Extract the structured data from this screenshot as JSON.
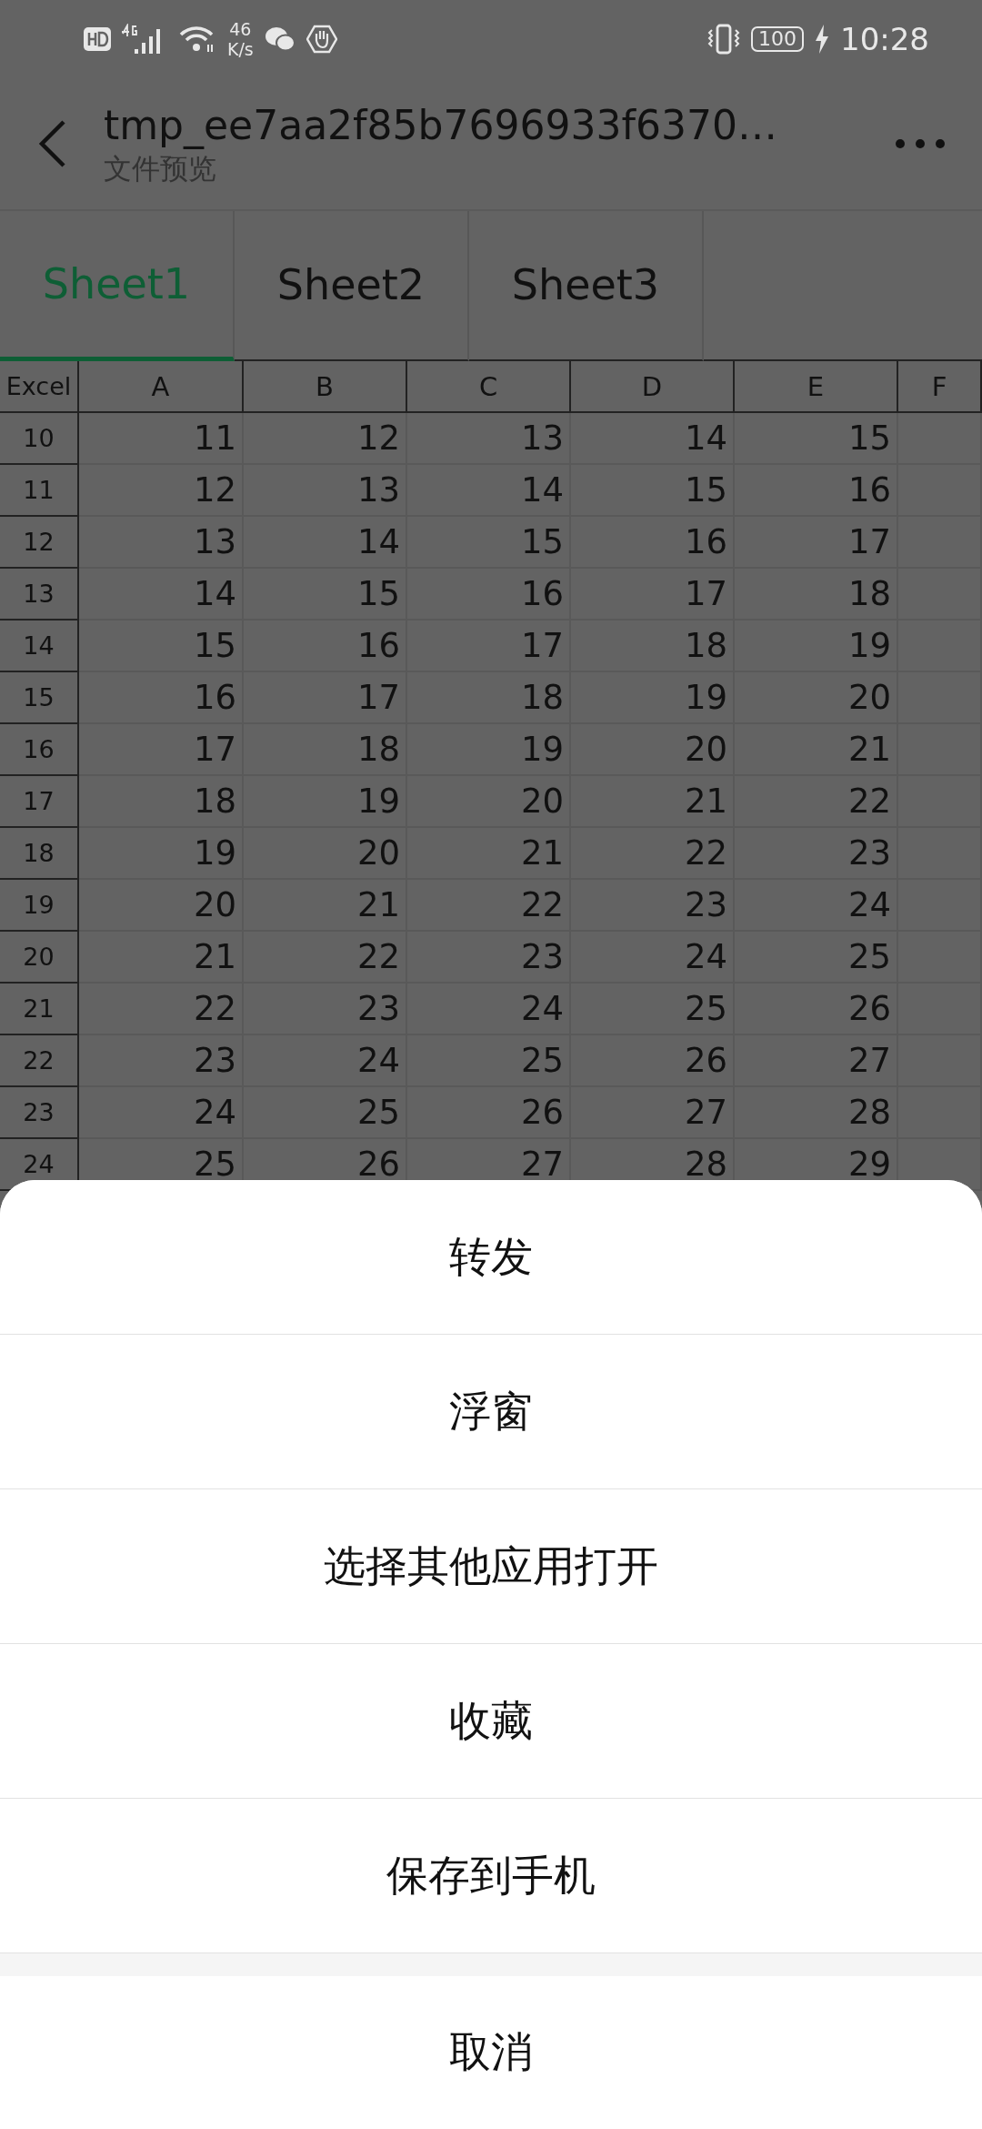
{
  "status_bar": {
    "speed_value": "46",
    "speed_unit": "K/s",
    "battery": "100",
    "time": "10:28"
  },
  "header": {
    "title": "tmp_ee7aa2f85b7696933f6370…",
    "subtitle": "文件预览"
  },
  "tabs": [
    {
      "label": "Sheet1",
      "selected": true
    },
    {
      "label": "Sheet2",
      "selected": false
    },
    {
      "label": "Sheet3",
      "selected": false
    }
  ],
  "table": {
    "columns": [
      "Excel",
      "A",
      "B",
      "C",
      "D",
      "E",
      "F"
    ],
    "rows": [
      {
        "header": "10",
        "cells": [
          "11",
          "12",
          "13",
          "14",
          "15"
        ]
      },
      {
        "header": "11",
        "cells": [
          "12",
          "13",
          "14",
          "15",
          "16"
        ]
      },
      {
        "header": "12",
        "cells": [
          "13",
          "14",
          "15",
          "16",
          "17"
        ]
      },
      {
        "header": "13",
        "cells": [
          "14",
          "15",
          "16",
          "17",
          "18"
        ]
      },
      {
        "header": "14",
        "cells": [
          "15",
          "16",
          "17",
          "18",
          "19"
        ]
      },
      {
        "header": "15",
        "cells": [
          "16",
          "17",
          "18",
          "19",
          "20"
        ]
      },
      {
        "header": "16",
        "cells": [
          "17",
          "18",
          "19",
          "20",
          "21"
        ]
      },
      {
        "header": "17",
        "cells": [
          "18",
          "19",
          "20",
          "21",
          "22"
        ]
      },
      {
        "header": "18",
        "cells": [
          "19",
          "20",
          "21",
          "22",
          "23"
        ]
      },
      {
        "header": "19",
        "cells": [
          "20",
          "21",
          "22",
          "23",
          "24"
        ]
      },
      {
        "header": "20",
        "cells": [
          "21",
          "22",
          "23",
          "24",
          "25"
        ]
      },
      {
        "header": "21",
        "cells": [
          "22",
          "23",
          "24",
          "25",
          "26"
        ]
      },
      {
        "header": "22",
        "cells": [
          "23",
          "24",
          "25",
          "26",
          "27"
        ]
      },
      {
        "header": "23",
        "cells": [
          "24",
          "25",
          "26",
          "27",
          "28"
        ]
      },
      {
        "header": "24",
        "cells": [
          "25",
          "26",
          "27",
          "28",
          "29"
        ]
      }
    ]
  },
  "action_sheet": {
    "items": [
      "转发",
      "浮窗",
      "选择其他应用打开",
      "收藏",
      "保存到手机"
    ],
    "cancel": "取消"
  }
}
